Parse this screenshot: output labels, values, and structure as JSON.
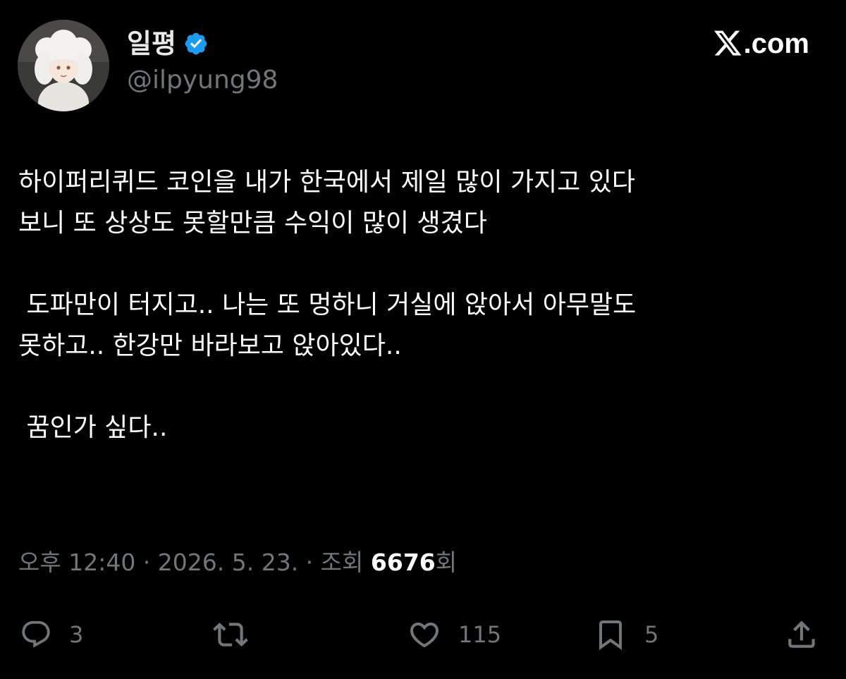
{
  "author": {
    "display_name": "일평",
    "handle": "@ilpyung98",
    "verified": true
  },
  "site": {
    "brand": ".com",
    "logo_icon": "x-logo-icon"
  },
  "tweet": {
    "text": "하이퍼리퀴드 코인을 내가 한국에서 제일 많이 가지고 있다\n보니 또 상상도 못할만큼 수익이 많이 생겼다\n\n 도파만이 터지고.. 나는 또 멍하니 거실에 앉아서 아무말도\n못하고.. 한강만 바라보고 앉아있다..\n\n 꿈인가 싶다.."
  },
  "meta": {
    "time_date": "오후 12:40 · 2026. 5. 23. · 조회 ",
    "views": "6676",
    "views_suffix": "회"
  },
  "actions": {
    "replies": "3",
    "reposts": "",
    "likes": "115",
    "bookmarks": "5"
  },
  "icons": {
    "reply": "reply-icon",
    "repost": "repost-icon",
    "like": "heart-icon",
    "bookmark": "bookmark-icon",
    "share": "share-icon",
    "verified": "verified-badge-icon"
  },
  "colors": {
    "background": "#000000",
    "text": "#ffffff",
    "secondary": "#71767b",
    "verified": "#1d9bf0"
  }
}
